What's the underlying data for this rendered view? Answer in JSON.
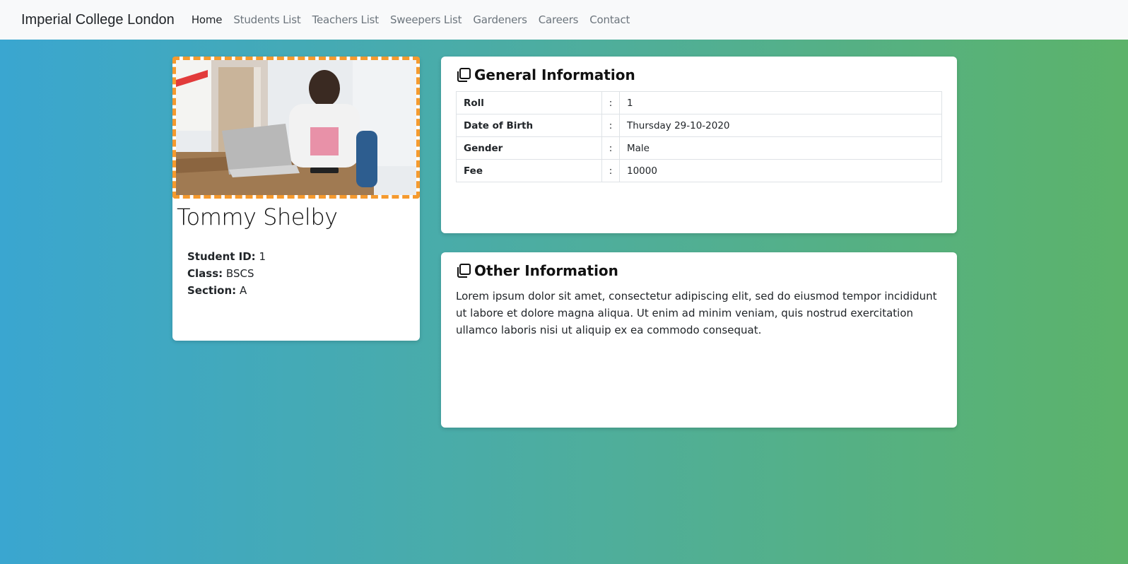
{
  "navbar": {
    "brand": "Imperial College London",
    "links": [
      "Home",
      "Students List",
      "Teachers List",
      "Sweepers List",
      "Gardeners",
      "Careers",
      "Contact"
    ]
  },
  "profile": {
    "name": "Tommy Shelby",
    "fields": [
      {
        "label": "Student ID:",
        "value": "1"
      },
      {
        "label": "Class:",
        "value": "BSCS"
      },
      {
        "label": "Section:",
        "value": "A"
      }
    ]
  },
  "general": {
    "title": "General Information",
    "rows": [
      {
        "key": "Roll",
        "sep": ":",
        "value": "1"
      },
      {
        "key": "Date of Birth",
        "sep": ":",
        "value": "Thursday 29-10-2020"
      },
      {
        "key": "Gender",
        "sep": ":",
        "value": "Male"
      },
      {
        "key": "Fee",
        "sep": ":",
        "value": "10000"
      }
    ]
  },
  "other": {
    "title": "Other Information",
    "text": "Lorem ipsum dolor sit amet, consectetur adipiscing elit, sed do eiusmod tempor incididunt ut labore et dolore magna aliqua. Ut enim ad minim veniam, quis nostrud exercitation ullamco laboris nisi ut aliquip ex ea commodo consequat."
  },
  "colors": {
    "photo_border": "#f59a2e",
    "gradient_start": "#3aa6d0",
    "gradient_end": "#5cb36a"
  },
  "icons": {
    "section_icon": "copy-icon"
  }
}
